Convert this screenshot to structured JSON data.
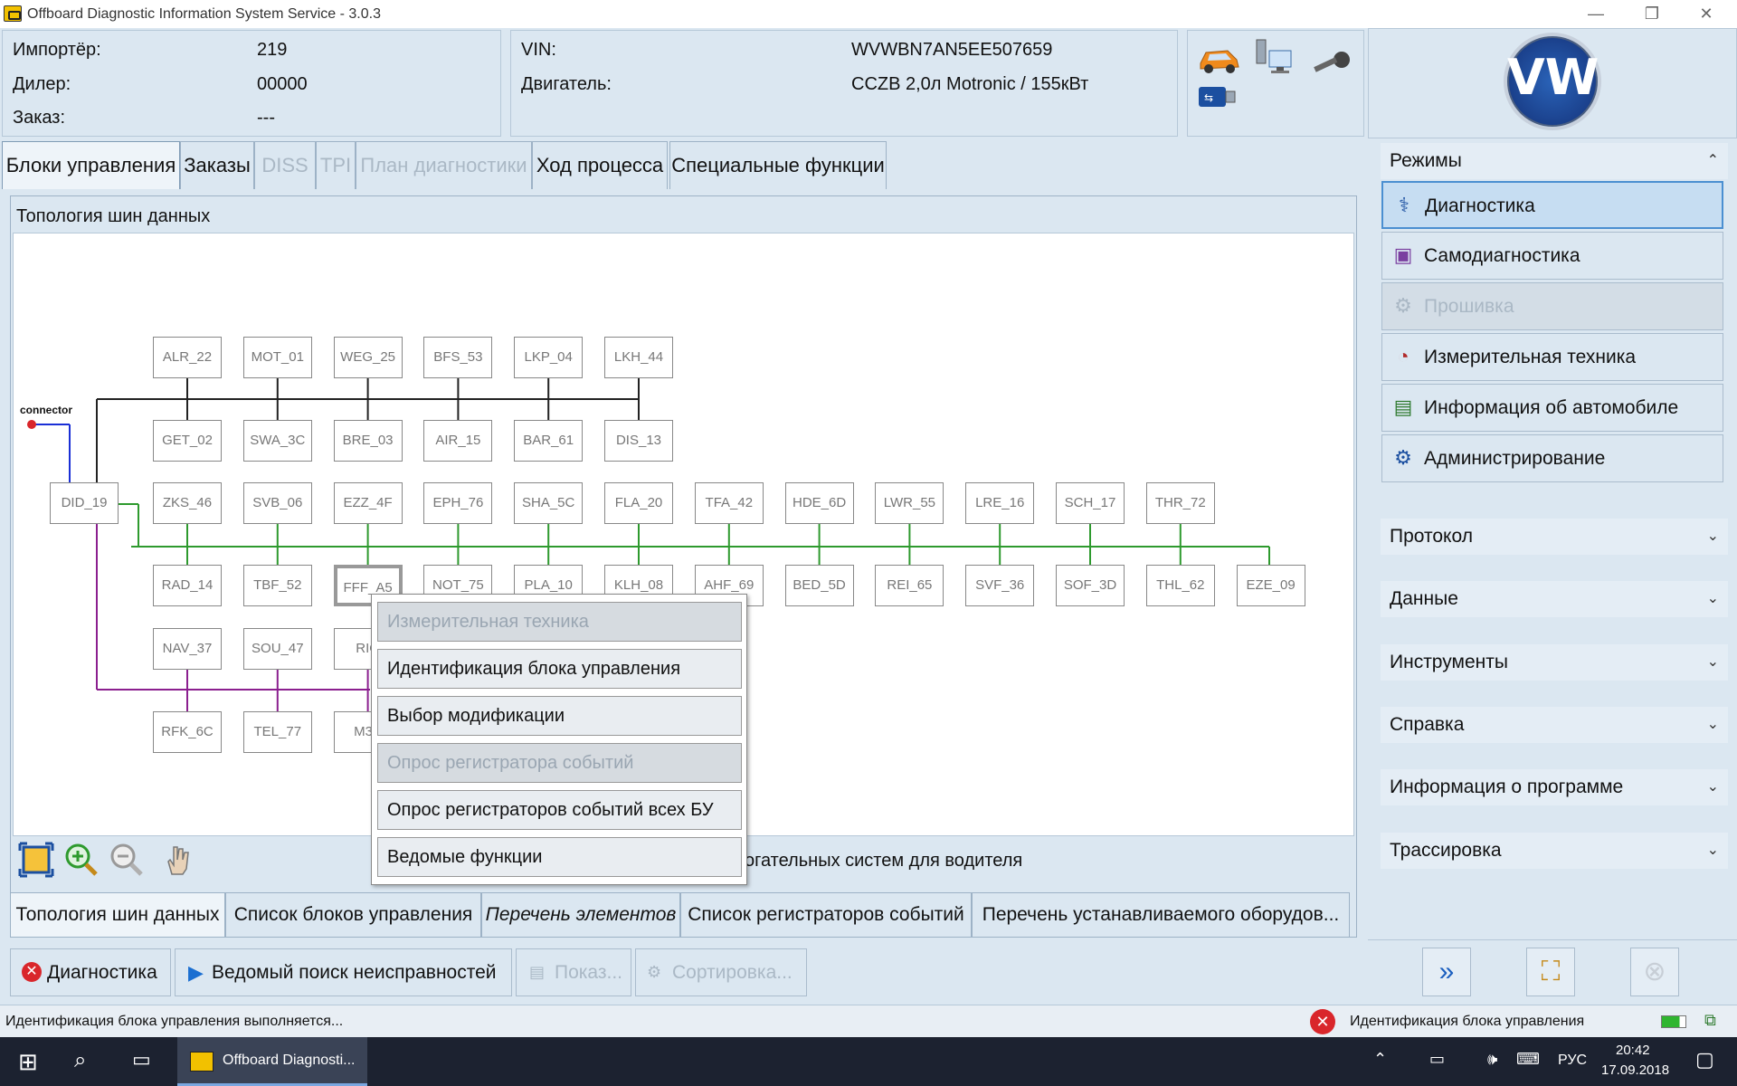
{
  "window": {
    "title": "Offboard Diagnostic Information System Service - 3.0.3",
    "min": "—",
    "restore": "❐",
    "close": "✕"
  },
  "info": {
    "importer_label": "Импортёр:",
    "importer_value": "219",
    "dealer_label": "Дилер:",
    "dealer_value": "00000",
    "order_label": "Заказ:",
    "order_value": "---",
    "vin_label": "VIN:",
    "vin_value": "WVWBN7AN5EE507659",
    "engine_label": "Двигатель:",
    "engine_value": "CCZB 2,0л Motronic / 155кВт"
  },
  "brand": {
    "logo_text": "VW"
  },
  "tabs": [
    {
      "label": "Блоки управления",
      "state": "active"
    },
    {
      "label": "Заказы",
      "state": "normal"
    },
    {
      "label": "DISS",
      "state": "disabled"
    },
    {
      "label": "TPI",
      "state": "disabled"
    },
    {
      "label": "План диагностики",
      "state": "disabled"
    },
    {
      "label": "Ход процесса",
      "state": "normal"
    },
    {
      "label": "Специальные функции",
      "state": "normal"
    }
  ],
  "topology": {
    "title": "Топология шин данных",
    "connector_label": "connector",
    "gateway": "DID_19",
    "nodes": {
      "r1": [
        "ALR_22",
        "MOT_01",
        "WEG_25",
        "BFS_53",
        "LKP_04",
        "LKH_44"
      ],
      "r2": [
        "GET_02",
        "SWA_3C",
        "BRE_03",
        "AIR_15",
        "BAR_61",
        "DIS_13"
      ],
      "r3": [
        "ZKS_46",
        "SVB_06",
        "EZZ_4F",
        "EPH_76",
        "SHA_5C",
        "FLA_20",
        "TFA_42",
        "HDE_6D",
        "LWR_55",
        "LRE_16",
        "SCH_17",
        "THR_72"
      ],
      "r4": [
        "RAD_14",
        "TBF_52",
        "FFF_A5",
        "NOT_75",
        "PLA_10",
        "KLH_08",
        "AHF_69",
        "BED_5D",
        "REI_65",
        "SVF_36",
        "SOF_3D",
        "THL_62",
        "EZE_09"
      ],
      "r5": [
        "NAV_37",
        "SOU_47",
        "RIO"
      ],
      "r6": [
        "RFK_6C",
        "TEL_77",
        "M3P"
      ]
    },
    "colors": {
      "black_bus": "#222222",
      "green_bus": "#2e9a2e",
      "purple_bus": "#8b1f8f",
      "blue_bus": "#1a2fd6"
    }
  },
  "zoom_extra": "огательных систем для водителя",
  "context_menu": [
    {
      "label": "Измерительная техника",
      "disabled": true
    },
    {
      "label": "Идентификация блока управления",
      "disabled": false
    },
    {
      "label": "Выбор модификации",
      "disabled": false
    },
    {
      "label": "Опрос регистратора событий",
      "disabled": true
    },
    {
      "label": "Опрос регистраторов событий всех БУ",
      "disabled": false
    },
    {
      "label": "Ведомые функции",
      "disabled": false
    }
  ],
  "bottom_tabs": [
    "Топология шин данных",
    "Список блоков управления",
    "Перечень элементов",
    "Список регистраторов событий",
    "Перечень устанавливаемого оборудов..."
  ],
  "actions": {
    "diagnostics": "Диагностика",
    "guided": "Ведомый поиск неисправностей",
    "show": "Показ...",
    "sort": "Сортировка..."
  },
  "sidebar": {
    "modes_title": "Режимы",
    "modes": [
      {
        "label": "Диагностика",
        "state": "active",
        "icon": "stethoscope-icon"
      },
      {
        "label": "Самодиагностика",
        "state": "normal",
        "icon": "self-diagnosis-icon"
      },
      {
        "label": "Прошивка",
        "state": "disabled",
        "icon": "flash-icon"
      },
      {
        "label": "Измерительная техника",
        "state": "normal",
        "icon": "gauge-icon"
      },
      {
        "label": "Информация об автомобиле",
        "state": "normal",
        "icon": "books-icon"
      },
      {
        "label": "Администрирование",
        "state": "normal",
        "icon": "admin-gear-icon"
      }
    ],
    "sections": [
      "Протокол",
      "Данные",
      "Инструменты",
      "Справка",
      "Информация о программе",
      "Трассировка"
    ]
  },
  "status": {
    "left": "Идентификация блока управления выполняется...",
    "right": "Идентификация блока управления"
  },
  "taskbar": {
    "app": "Offboard Diagnosti...",
    "lang": "РУС",
    "time": "20:42",
    "date": "17.09.2018"
  }
}
